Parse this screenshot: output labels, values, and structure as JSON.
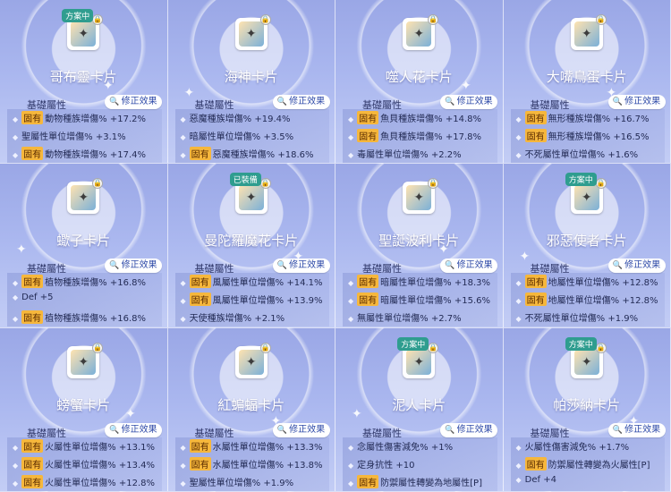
{
  "ui": {
    "base_label": "基礎屬性",
    "modify_label": "修正效果",
    "fixed_tag": "固有",
    "lock_glyph": "🔒"
  },
  "cards": [
    {
      "name": "哥布靈卡片",
      "badge": "方案中",
      "icon": "goblin-card-icon",
      "attrs": [
        {
          "fixed": true,
          "text": "動物種族增傷% +17.2%"
        },
        {
          "fixed": false,
          "text": "聖屬性單位增傷% +3.1%"
        },
        {
          "fixed": true,
          "text": "動物種族增傷% +17.4%"
        }
      ]
    },
    {
      "name": "海神卡片",
      "badge": "",
      "icon": "poseidon-card-icon",
      "attrs": [
        {
          "fixed": false,
          "text": "惡魔種族增傷% +19.4%"
        },
        {
          "fixed": false,
          "text": "暗屬性單位增傷% +3.5%"
        },
        {
          "fixed": true,
          "text": "惡魔種族增傷% +18.6%"
        }
      ]
    },
    {
      "name": "噬人花卡片",
      "badge": "",
      "icon": "flora-card-icon",
      "attrs": [
        {
          "fixed": true,
          "text": "魚貝種族增傷% +14.8%"
        },
        {
          "fixed": true,
          "text": "魚貝種族增傷% +17.8%"
        },
        {
          "fixed": false,
          "text": "毒屬性單位增傷% +2.2%"
        }
      ]
    },
    {
      "name": "大嘴鳥蛋卡片",
      "badge": "",
      "icon": "egg-card-icon",
      "attrs": [
        {
          "fixed": true,
          "text": "無形種族增傷% +16.7%"
        },
        {
          "fixed": true,
          "text": "無形種族增傷% +16.5%"
        },
        {
          "fixed": false,
          "text": "不死屬性單位增傷% +1.6%"
        }
      ]
    },
    {
      "name": "蠍子卡片",
      "badge": "",
      "icon": "scorpion-card-icon",
      "attrs": [
        {
          "fixed": true,
          "text": "植物種族增傷% +16.8%"
        },
        {
          "fixed": false,
          "text": "Def +5"
        },
        {
          "fixed": true,
          "text": "植物種族增傷% +16.8%"
        }
      ]
    },
    {
      "name": "曼陀羅魔花卡片",
      "badge": "已裝備",
      "icon": "mandragora-card-icon",
      "attrs": [
        {
          "fixed": true,
          "text": "風屬性單位增傷% +14.1%"
        },
        {
          "fixed": true,
          "text": "風屬性單位增傷% +13.9%"
        },
        {
          "fixed": false,
          "text": "天使種族增傷% +2.1%"
        }
      ]
    },
    {
      "name": "聖誕波利卡片",
      "badge": "",
      "icon": "santa-poring-card-icon",
      "attrs": [
        {
          "fixed": true,
          "text": "暗屬性單位增傷% +18.3%"
        },
        {
          "fixed": true,
          "text": "暗屬性單位增傷% +15.6%"
        },
        {
          "fixed": false,
          "text": "無屬性單位增傷% +2.7%"
        }
      ]
    },
    {
      "name": "邪惡使者卡片",
      "badge": "方案中",
      "icon": "evil-messenger-card-icon",
      "attrs": [
        {
          "fixed": true,
          "text": "地屬性單位增傷% +12.8%"
        },
        {
          "fixed": true,
          "text": "地屬性單位增傷% +12.8%"
        },
        {
          "fixed": false,
          "text": "不死屬性單位增傷% +1.9%"
        }
      ]
    },
    {
      "name": "螃蟹卡片",
      "badge": "",
      "icon": "crab-card-icon",
      "attrs": [
        {
          "fixed": true,
          "text": "火屬性單位增傷% +13.1%"
        },
        {
          "fixed": true,
          "text": "火屬性單位增傷% +13.4%"
        },
        {
          "fixed": true,
          "text": "火屬性單位增傷% +12.8%"
        }
      ]
    },
    {
      "name": "紅蝙蝠卡片",
      "badge": "",
      "icon": "red-bat-card-icon",
      "attrs": [
        {
          "fixed": true,
          "text": "水屬性單位增傷% +13.3%"
        },
        {
          "fixed": true,
          "text": "水屬性單位增傷% +13.8%"
        },
        {
          "fixed": false,
          "text": "聖屬性單位增傷% +1.9%"
        }
      ]
    },
    {
      "name": "泥人卡片",
      "badge": "方案中",
      "icon": "mud-man-card-icon",
      "attrs": [
        {
          "fixed": false,
          "text": "念屬性傷害減免% +1%"
        },
        {
          "fixed": false,
          "text": "定身抗性 +10"
        },
        {
          "fixed": true,
          "text": "防禦屬性轉變為地屬性[P]"
        }
      ]
    },
    {
      "name": "帕莎納卡片",
      "badge": "方案中",
      "icon": "pasana-card-icon",
      "attrs": [
        {
          "fixed": false,
          "text": "火屬性傷害減免% +1.7%"
        },
        {
          "fixed": true,
          "text": "防禦屬性轉變為火屬性[P]"
        },
        {
          "fixed": false,
          "text": "Def +4"
        }
      ]
    }
  ]
}
